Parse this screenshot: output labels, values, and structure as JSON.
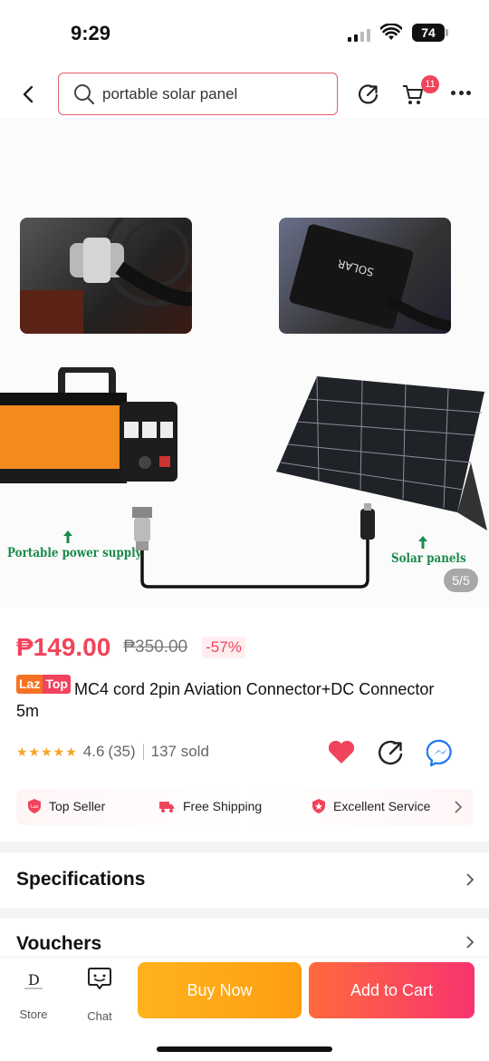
{
  "status_bar": {
    "time": "9:29",
    "battery": "74"
  },
  "header": {
    "search_value": "portable solar panel",
    "cart_count": "11",
    "icons": [
      "back-arrow-icon",
      "search-icon",
      "share-icon",
      "cart-icon",
      "more-icon"
    ]
  },
  "gallery": {
    "label_power": "Portable power supply",
    "label_solar": "Solar panels",
    "counter": "5/5"
  },
  "product": {
    "price": "₱149.00",
    "original_price": "₱350.00",
    "discount": "-57%",
    "badge_part1": "Laz",
    "badge_part2": "Top",
    "title": "MC4 cord 2pin Aviation Connector+DC Connector 5m",
    "stars": "★★★★★",
    "rating": "4.6",
    "rating_count": "(35)",
    "sold": "137 sold"
  },
  "services": [
    {
      "label": "Top Seller",
      "icon": "laz-shield-icon"
    },
    {
      "label": "Free Shipping",
      "icon": "truck-icon"
    },
    {
      "label": "Excellent Service",
      "icon": "star-badge-icon"
    }
  ],
  "sections": {
    "specifications": "Specifications",
    "vouchers": "Vouchers"
  },
  "bottom_bar": {
    "store_logo_text": "D",
    "store_label": "Store",
    "chat_label": "Chat",
    "buy_now": "Buy Now",
    "add_to_cart": "Add to Cart"
  },
  "colors": {
    "accent": "#f0445c",
    "buy_now": "#ffa817",
    "add_to_cart": "#f8336f",
    "rating_star": "#f5a623",
    "label_green": "#1b8a4c"
  }
}
